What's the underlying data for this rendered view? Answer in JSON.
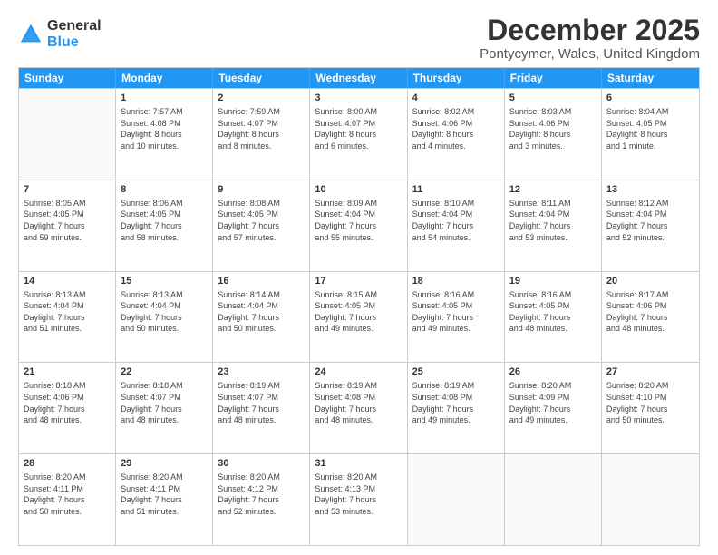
{
  "logo": {
    "general": "General",
    "blue": "Blue"
  },
  "title": "December 2025",
  "location": "Pontycymer, Wales, United Kingdom",
  "days": [
    "Sunday",
    "Monday",
    "Tuesday",
    "Wednesday",
    "Thursday",
    "Friday",
    "Saturday"
  ],
  "rows": [
    [
      {
        "day": "",
        "info": ""
      },
      {
        "day": "1",
        "info": "Sunrise: 7:57 AM\nSunset: 4:08 PM\nDaylight: 8 hours\nand 10 minutes."
      },
      {
        "day": "2",
        "info": "Sunrise: 7:59 AM\nSunset: 4:07 PM\nDaylight: 8 hours\nand 8 minutes."
      },
      {
        "day": "3",
        "info": "Sunrise: 8:00 AM\nSunset: 4:07 PM\nDaylight: 8 hours\nand 6 minutes."
      },
      {
        "day": "4",
        "info": "Sunrise: 8:02 AM\nSunset: 4:06 PM\nDaylight: 8 hours\nand 4 minutes."
      },
      {
        "day": "5",
        "info": "Sunrise: 8:03 AM\nSunset: 4:06 PM\nDaylight: 8 hours\nand 3 minutes."
      },
      {
        "day": "6",
        "info": "Sunrise: 8:04 AM\nSunset: 4:05 PM\nDaylight: 8 hours\nand 1 minute."
      }
    ],
    [
      {
        "day": "7",
        "info": "Sunrise: 8:05 AM\nSunset: 4:05 PM\nDaylight: 7 hours\nand 59 minutes."
      },
      {
        "day": "8",
        "info": "Sunrise: 8:06 AM\nSunset: 4:05 PM\nDaylight: 7 hours\nand 58 minutes."
      },
      {
        "day": "9",
        "info": "Sunrise: 8:08 AM\nSunset: 4:05 PM\nDaylight: 7 hours\nand 57 minutes."
      },
      {
        "day": "10",
        "info": "Sunrise: 8:09 AM\nSunset: 4:04 PM\nDaylight: 7 hours\nand 55 minutes."
      },
      {
        "day": "11",
        "info": "Sunrise: 8:10 AM\nSunset: 4:04 PM\nDaylight: 7 hours\nand 54 minutes."
      },
      {
        "day": "12",
        "info": "Sunrise: 8:11 AM\nSunset: 4:04 PM\nDaylight: 7 hours\nand 53 minutes."
      },
      {
        "day": "13",
        "info": "Sunrise: 8:12 AM\nSunset: 4:04 PM\nDaylight: 7 hours\nand 52 minutes."
      }
    ],
    [
      {
        "day": "14",
        "info": "Sunrise: 8:13 AM\nSunset: 4:04 PM\nDaylight: 7 hours\nand 51 minutes."
      },
      {
        "day": "15",
        "info": "Sunrise: 8:13 AM\nSunset: 4:04 PM\nDaylight: 7 hours\nand 50 minutes."
      },
      {
        "day": "16",
        "info": "Sunrise: 8:14 AM\nSunset: 4:04 PM\nDaylight: 7 hours\nand 50 minutes."
      },
      {
        "day": "17",
        "info": "Sunrise: 8:15 AM\nSunset: 4:05 PM\nDaylight: 7 hours\nand 49 minutes."
      },
      {
        "day": "18",
        "info": "Sunrise: 8:16 AM\nSunset: 4:05 PM\nDaylight: 7 hours\nand 49 minutes."
      },
      {
        "day": "19",
        "info": "Sunrise: 8:16 AM\nSunset: 4:05 PM\nDaylight: 7 hours\nand 48 minutes."
      },
      {
        "day": "20",
        "info": "Sunrise: 8:17 AM\nSunset: 4:06 PM\nDaylight: 7 hours\nand 48 minutes."
      }
    ],
    [
      {
        "day": "21",
        "info": "Sunrise: 8:18 AM\nSunset: 4:06 PM\nDaylight: 7 hours\nand 48 minutes."
      },
      {
        "day": "22",
        "info": "Sunrise: 8:18 AM\nSunset: 4:07 PM\nDaylight: 7 hours\nand 48 minutes."
      },
      {
        "day": "23",
        "info": "Sunrise: 8:19 AM\nSunset: 4:07 PM\nDaylight: 7 hours\nand 48 minutes."
      },
      {
        "day": "24",
        "info": "Sunrise: 8:19 AM\nSunset: 4:08 PM\nDaylight: 7 hours\nand 48 minutes."
      },
      {
        "day": "25",
        "info": "Sunrise: 8:19 AM\nSunset: 4:08 PM\nDaylight: 7 hours\nand 49 minutes."
      },
      {
        "day": "26",
        "info": "Sunrise: 8:20 AM\nSunset: 4:09 PM\nDaylight: 7 hours\nand 49 minutes."
      },
      {
        "day": "27",
        "info": "Sunrise: 8:20 AM\nSunset: 4:10 PM\nDaylight: 7 hours\nand 50 minutes."
      }
    ],
    [
      {
        "day": "28",
        "info": "Sunrise: 8:20 AM\nSunset: 4:11 PM\nDaylight: 7 hours\nand 50 minutes."
      },
      {
        "day": "29",
        "info": "Sunrise: 8:20 AM\nSunset: 4:11 PM\nDaylight: 7 hours\nand 51 minutes."
      },
      {
        "day": "30",
        "info": "Sunrise: 8:20 AM\nSunset: 4:12 PM\nDaylight: 7 hours\nand 52 minutes."
      },
      {
        "day": "31",
        "info": "Sunrise: 8:20 AM\nSunset: 4:13 PM\nDaylight: 7 hours\nand 53 minutes."
      },
      {
        "day": "",
        "info": ""
      },
      {
        "day": "",
        "info": ""
      },
      {
        "day": "",
        "info": ""
      }
    ]
  ]
}
